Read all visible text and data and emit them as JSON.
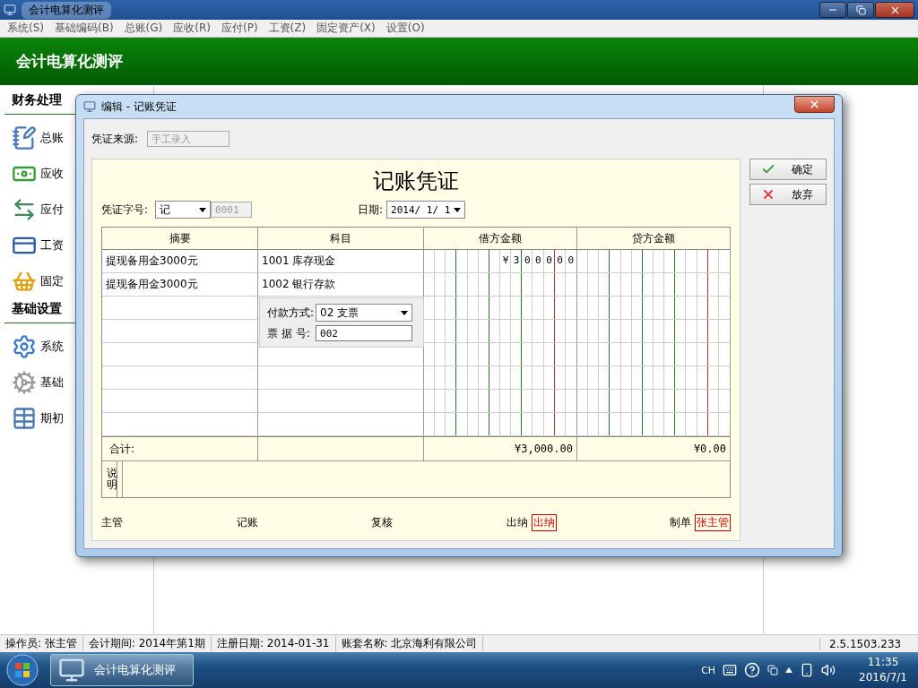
{
  "window": {
    "title": "会计电算化测评"
  },
  "menu": [
    "系统(S)",
    "基础编码(B)",
    "总账(G)",
    "应收(R)",
    "应付(P)",
    "工资(Z)",
    "固定资产(X)",
    "设置(O)"
  ],
  "banner": {
    "title": "会计电算化测评"
  },
  "sidebar": {
    "sections": [
      {
        "title": "财务处理",
        "items": [
          {
            "label": "总账",
            "kind": "ledger"
          },
          {
            "label": "应收",
            "kind": "receivable"
          },
          {
            "label": "应付",
            "kind": "payable"
          },
          {
            "label": "工资",
            "kind": "salary"
          },
          {
            "label": "固定",
            "kind": "asset"
          }
        ]
      },
      {
        "title": "基础设置",
        "items": [
          {
            "label": "系统",
            "kind": "system"
          },
          {
            "label": "基础",
            "kind": "basic"
          },
          {
            "label": "期初",
            "kind": "opening"
          }
        ]
      }
    ]
  },
  "dialog": {
    "title": "编辑 - 记账凭证",
    "source_label": "凭证来源:",
    "source": {
      "value": "手工录入",
      "disabled": true
    },
    "buttons": [
      {
        "label": "确定",
        "kind": "ok"
      },
      {
        "label": "放弃",
        "kind": "cancel"
      }
    ],
    "voucher": {
      "title": "记账凭证",
      "word_label": "凭证字号:",
      "word": "记",
      "number": {
        "value": "0001",
        "disabled": true
      },
      "date_label": "日期:",
      "date": "2014/ 1/ 1",
      "columns": [
        "摘要",
        "科目",
        "借方金额",
        "贷方金额"
      ],
      "rows": [
        {
          "summary": "提现备用金3000元",
          "account": "1001 库存现金",
          "debit": "¥300000"
        },
        {
          "summary": "提现备用金3000元",
          "account": "1002 银行存款"
        }
      ],
      "popup": {
        "payment_label": "付款方式:",
        "payment": "02 支票",
        "ticket_label": "票 据 号:",
        "ticket": "002"
      },
      "totals": {
        "label": "合计:",
        "debit": "¥3,000.00",
        "credit": "¥0.00"
      },
      "note_label": "说明",
      "signatures": [
        {
          "label": "主管"
        },
        {
          "label": "记账"
        },
        {
          "label": "复核"
        },
        {
          "label": "出纳",
          "stamp": "出纳"
        },
        {
          "label": "制单",
          "stamp": "张主管"
        }
      ]
    }
  },
  "status_bar": {
    "fields": [
      "操作员: 张主管",
      "会计期间: 2014年第1期",
      "注册日期: 2014-01-31",
      "账套名称: 北京海利有限公司"
    ],
    "version": "2.5.1503.233"
  },
  "taskbar": {
    "task": "会计电算化测评",
    "language": "CH",
    "time": "11:35",
    "date": "2016/7/1"
  }
}
